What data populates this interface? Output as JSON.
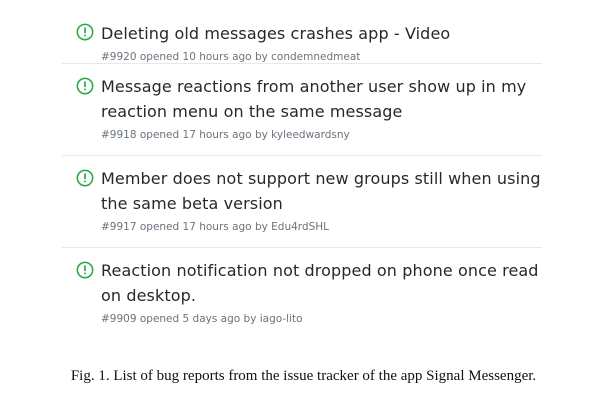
{
  "issues": [
    {
      "title": "Deleting old messages crashes app - Video",
      "meta": "#9920 opened 10 hours ago by condemnedmeat",
      "status_icon": "issue-opened-icon",
      "status_color": "#28a745"
    },
    {
      "title": "Message reactions from another user show up in my reaction menu on the same message",
      "meta": "#9918 opened 17 hours ago by kyleedwardsny",
      "status_icon": "issue-opened-icon",
      "status_color": "#28a745"
    },
    {
      "title": "Member does not support new groups still when using the same beta version",
      "meta": "#9917 opened 17 hours ago by Edu4rdSHL",
      "status_icon": "issue-opened-icon",
      "status_color": "#28a745"
    },
    {
      "title": "Reaction notification not dropped on phone once read on desktop.",
      "meta": "#9909 opened 5 days ago by iago-lito",
      "status_icon": "issue-opened-icon",
      "status_color": "#28a745"
    }
  ],
  "caption": "Fig. 1.  List of bug reports from the issue tracker of the app Signal Messenger."
}
